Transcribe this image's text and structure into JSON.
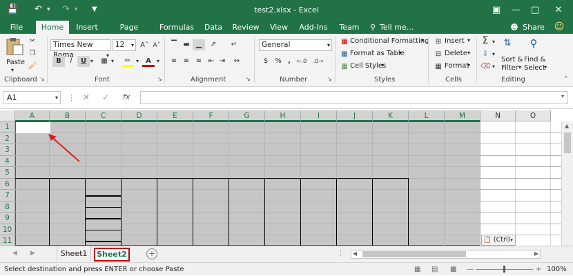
{
  "window": {
    "title": "test2.xlsx - Excel"
  },
  "menu": {
    "tabs": [
      "File",
      "Home",
      "Insert",
      "Page Layout",
      "Formulas",
      "Data",
      "Review",
      "View",
      "Add-Ins",
      "Team"
    ],
    "tell_me": "Tell me...",
    "share": "Share"
  },
  "ribbon": {
    "clipboard": {
      "paste": "Paste",
      "label": "Clipboard"
    },
    "font": {
      "name": "Times New Roma",
      "size": "12",
      "label": "Font",
      "bold": "B",
      "italic": "I",
      "underline": "U"
    },
    "alignment": {
      "label": "Alignment"
    },
    "number": {
      "format": "General",
      "label": "Number",
      "currency": "$",
      "percent": "%",
      "comma": ","
    },
    "styles": {
      "cond": "Conditional Formatting",
      "table": "Format as Table",
      "cell": "Cell Styles",
      "label": "Styles"
    },
    "cells": {
      "insert": "Insert",
      "delete": "Delete",
      "format": "Format",
      "label": "Cells"
    },
    "editing": {
      "sort": "Sort &",
      "sort2": "Filter",
      "find": "Find &",
      "find2": "Select",
      "label": "Editing"
    }
  },
  "formula": {
    "namebox": "A1",
    "fx": "fx"
  },
  "grid": {
    "columns": [
      "A",
      "B",
      "C",
      "D",
      "E",
      "F",
      "G",
      "H",
      "I",
      "J",
      "K",
      "L",
      "M",
      "N",
      "O"
    ],
    "rows": [
      "1",
      "2",
      "3",
      "4",
      "5",
      "6",
      "7",
      "8",
      "9",
      "10",
      "11"
    ]
  },
  "paste_options": {
    "label": "(Ctrl)"
  },
  "sheets": {
    "tabs": [
      "Sheet1",
      "Sheet2"
    ],
    "active": "Sheet2"
  },
  "status": {
    "message": "Select destination and press ENTER or choose Paste",
    "zoom": "100%"
  },
  "colors": {
    "accent": "#217346",
    "highlight": "#c00000"
  }
}
